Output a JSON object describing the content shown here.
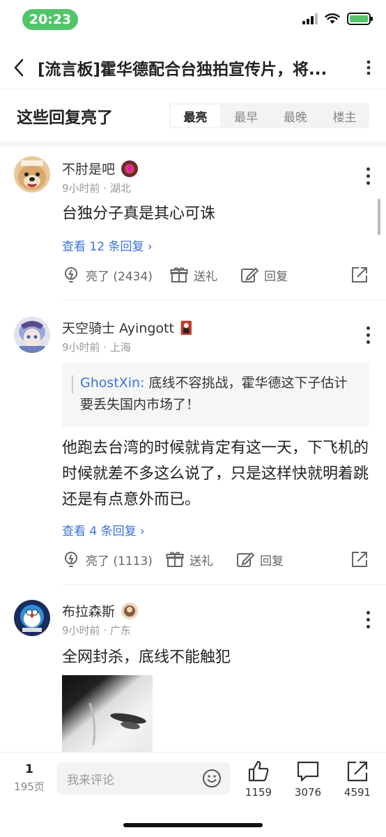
{
  "status_bar": {
    "time": "20:23"
  },
  "header": {
    "title": "[流言板]霍华德配合台独拍宣传片，将..."
  },
  "section": {
    "title": "这些回复亮了",
    "tabs": [
      {
        "label": "最亮",
        "active": true
      },
      {
        "label": "最早",
        "active": false
      },
      {
        "label": "最晚",
        "active": false
      },
      {
        "label": "楼主",
        "active": false
      }
    ]
  },
  "comments": [
    {
      "name": "不肘是吧",
      "meta": "9小时前 · 湖北",
      "text": "台独分子真是其心可诛",
      "reply_link": "查看 12 条回复 ›",
      "like": "亮了 (2434)",
      "gift": "送礼",
      "reply": "回复"
    },
    {
      "name": "天空骑士 Ayingott",
      "meta": "9小时前 · 上海",
      "quote_user": "GhostXin:",
      "quote_text": " 底线不容挑战，霍华德这下子估计要丢失国内市场了！",
      "text": "他跑去台湾的时候就肯定有这一天，下飞机的时候就差不多这么说了，只是这样快就明着跳还是有点意外而已。",
      "reply_link": "查看 4 条回复 ›",
      "like": "亮了 (1113)",
      "gift": "送礼",
      "reply": "回复"
    },
    {
      "name": "布拉森斯",
      "meta": "9小时前 · 广东",
      "text": "全网封杀，底线不能触犯"
    }
  ],
  "bottom_bar": {
    "page_current": "1",
    "page_total": "195页",
    "input_placeholder": "我来评论",
    "likes": "1159",
    "comments": "3076",
    "shares": "4591"
  },
  "colors": {
    "accent": "#3b74d9",
    "time_pill": "#53c46a"
  }
}
